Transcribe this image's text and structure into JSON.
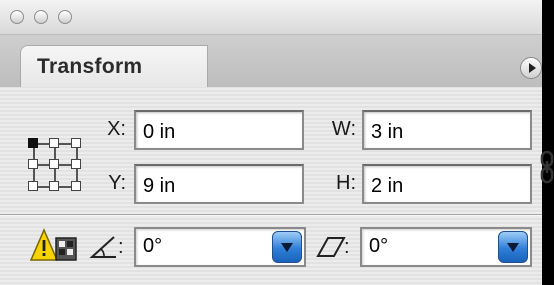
{
  "panel": {
    "tab_label": "Transform"
  },
  "position": {
    "x_label": "X:",
    "x_value": "0 in",
    "y_label": "Y:",
    "y_value": "9 in"
  },
  "size": {
    "w_label": "W:",
    "w_value": "3 in",
    "h_label": "H:",
    "h_value": "2 in"
  },
  "rotate": {
    "colon": ":",
    "value": "0°"
  },
  "shear": {
    "colon": ":",
    "value": "0°"
  },
  "reference_point": {
    "selected": "top-left"
  },
  "icons": {
    "close": "close-icon",
    "minimize": "minimize-icon",
    "zoom": "zoom-icon",
    "menu": "panel-menu-icon",
    "link": "constrain-proportions-icon",
    "warning": "warning-icon",
    "rotate": "rotate-angle-icon",
    "shear": "shear-angle-icon"
  },
  "colors": {
    "dropdown_accent": "#2f7fd8",
    "warning_yellow": "#f5d400"
  }
}
